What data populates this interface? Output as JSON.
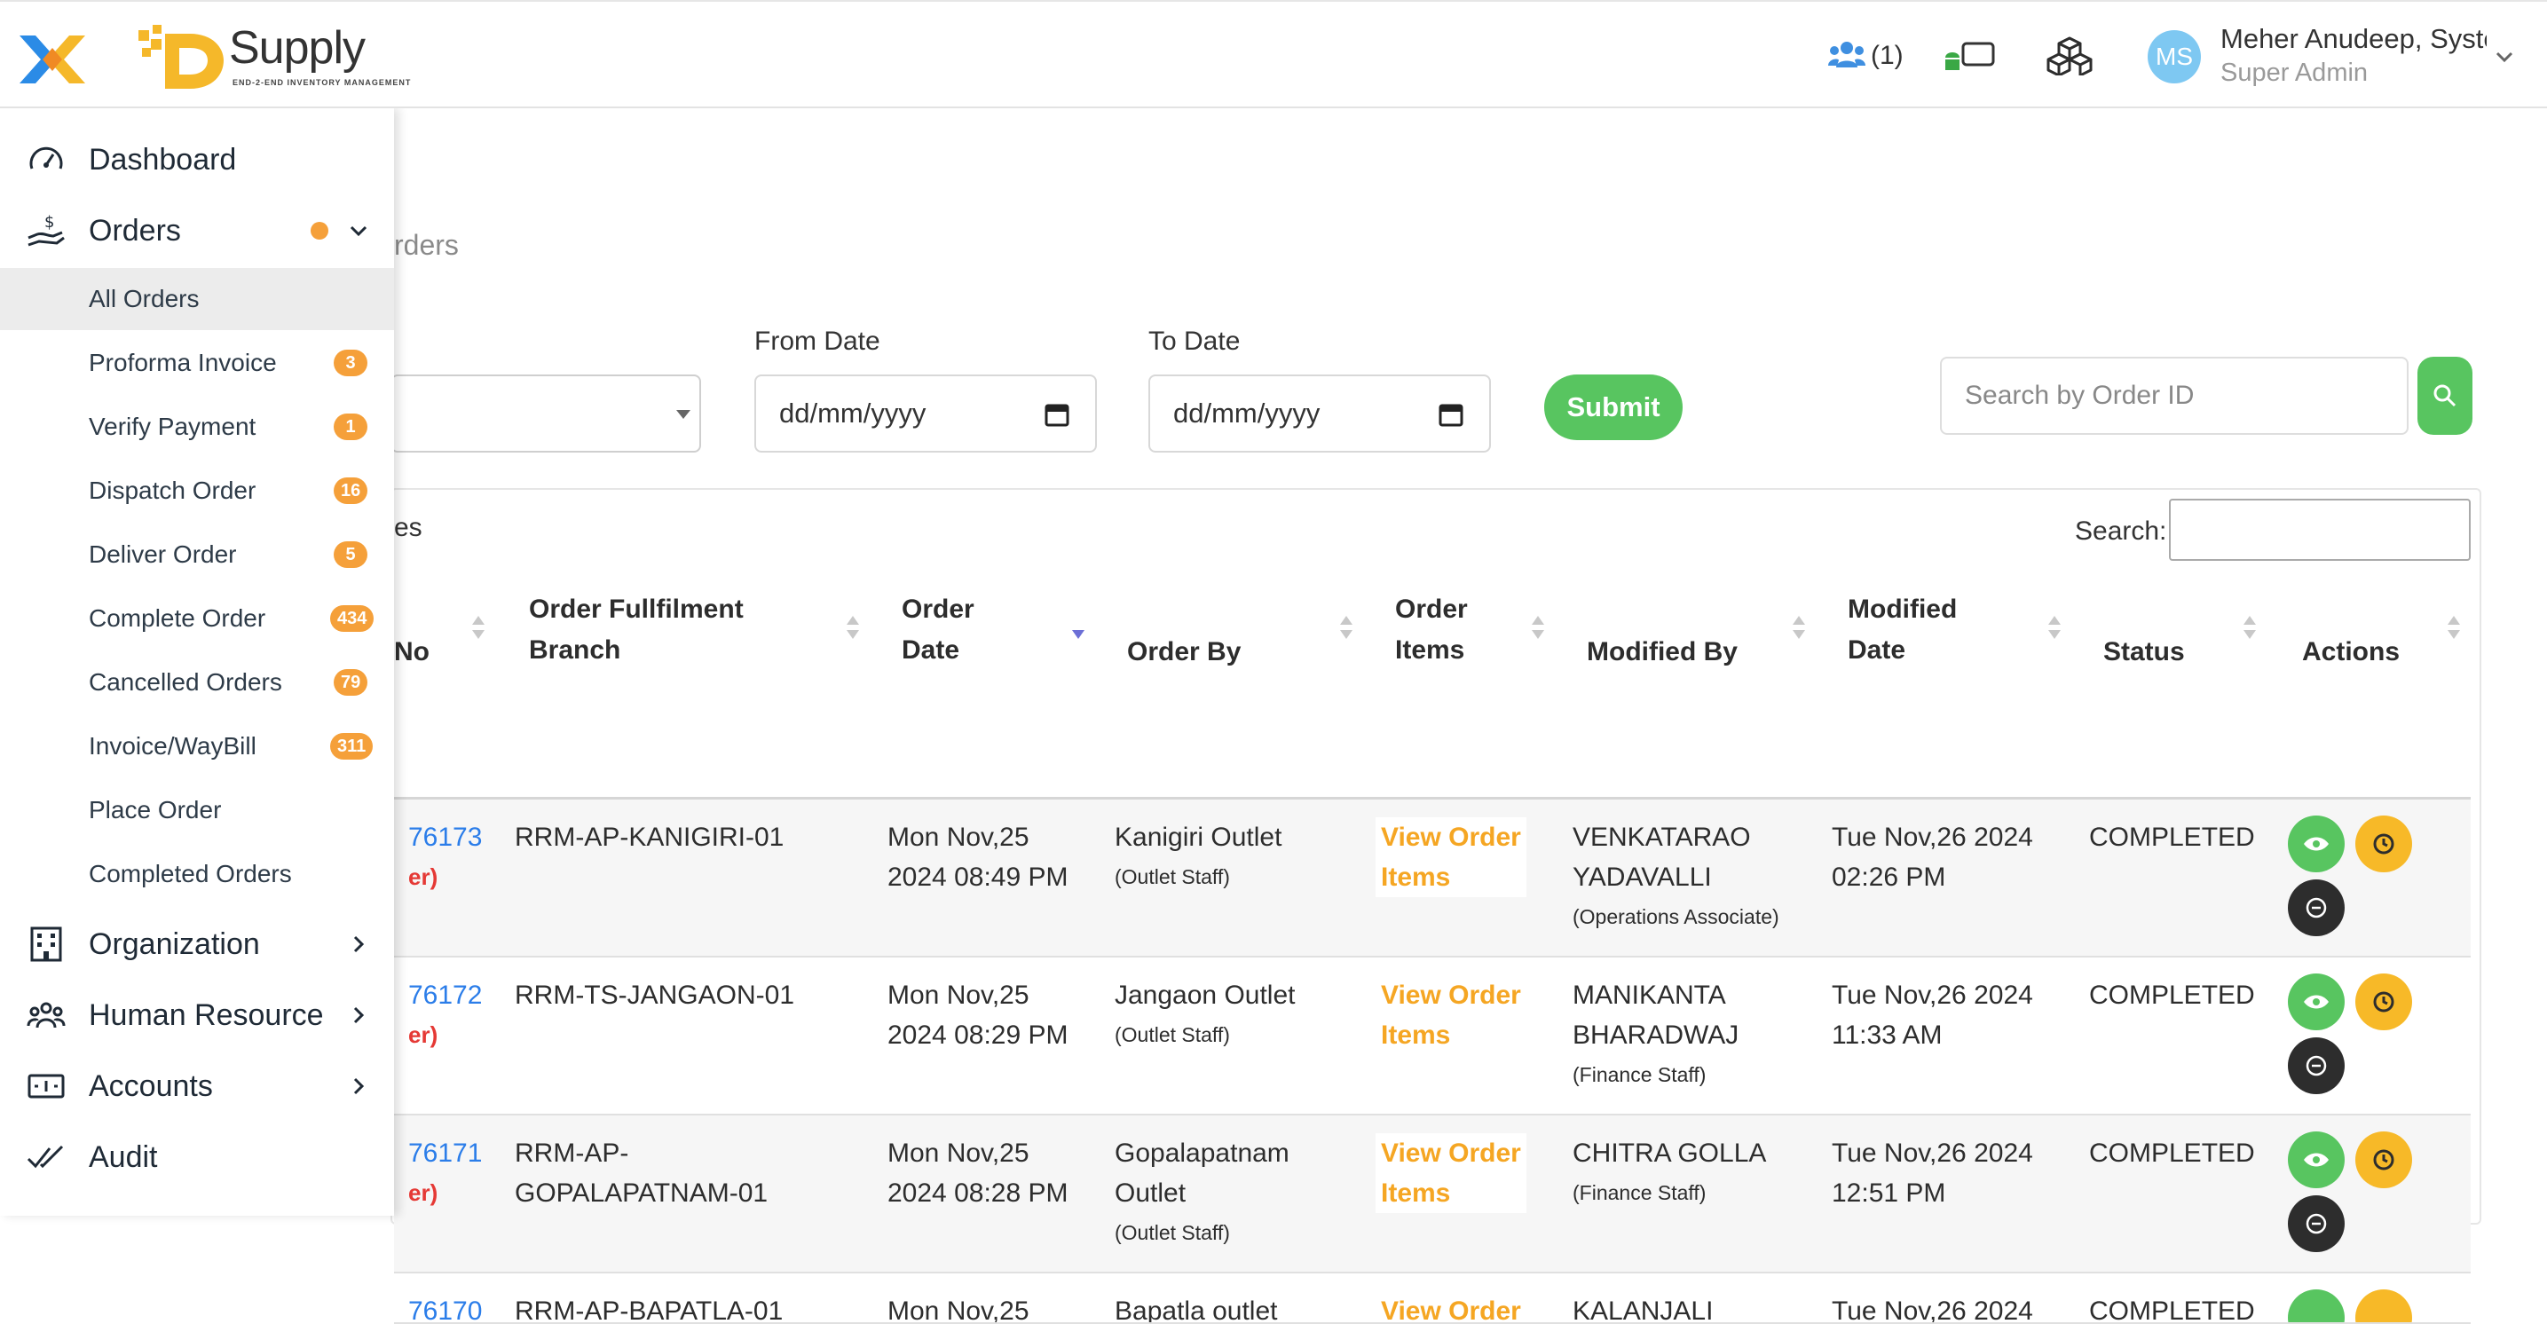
{
  "header": {
    "brand_word": "Supply",
    "brand_tagline": "END-2-END INVENTORY MANAGEMENT",
    "users_count": "(1)",
    "avatar_initials": "MS",
    "user_name": "Meher Anudeep, Syste",
    "user_role": "Super Admin"
  },
  "sidebar": {
    "dashboard": "Dashboard",
    "orders": "Orders",
    "sub_items": [
      {
        "label": "All Orders",
        "badge": ""
      },
      {
        "label": "Proforma Invoice",
        "badge": "3"
      },
      {
        "label": "Verify Payment",
        "badge": "1"
      },
      {
        "label": "Dispatch Order",
        "badge": "16"
      },
      {
        "label": "Deliver Order",
        "badge": "5"
      },
      {
        "label": "Complete Order",
        "badge": "434"
      },
      {
        "label": "Cancelled Orders",
        "badge": "79"
      },
      {
        "label": "Invoice/WayBill",
        "badge": "311"
      },
      {
        "label": "Place Order",
        "badge": ""
      },
      {
        "label": "Completed Orders",
        "badge": ""
      }
    ],
    "organization": "Organization",
    "human_resource": "Human Resource",
    "accounts": "Accounts",
    "audit": "Audit"
  },
  "main": {
    "breadcrumb": "rders",
    "from_date_label": "From Date",
    "to_date_label": "To Date",
    "date_placeholder": "dd/mm/yyyy",
    "submit": "Submit",
    "search_order_placeholder": "Search by Order ID",
    "entries_fragment": "es",
    "search_label": "Search:"
  },
  "table": {
    "headers": {
      "no": "No",
      "branch_1": "Order Fullfilment",
      "branch_2": "Branch",
      "date_1": "Order",
      "date_2": "Date",
      "by": "Order By",
      "items_1": "Order",
      "items_2": "Items",
      "modified_by": "Modified By",
      "mdate_1": "Modified",
      "mdate_2": "Date",
      "status": "Status",
      "actions": "Actions"
    },
    "view_items_1": "View Order",
    "view_items_2": "Items",
    "rows": [
      {
        "id": "76173",
        "id_sub": "er)",
        "branch_1": "RRM-AP-KANIGIRI-01",
        "branch_2": "",
        "date_1": "Mon Nov,25",
        "date_2": "2024 08:49 PM",
        "by_1": "Kanigiri Outlet",
        "by_2": "",
        "by_role": "(Outlet Staff)",
        "mod_1": "VENKATARAO",
        "mod_2": "YADAVALLI",
        "mod_role": "(Operations Associate)",
        "mdate_1": "Tue Nov,26 2024",
        "mdate_2": "02:26 PM",
        "status": "COMPLETED"
      },
      {
        "id": "76172",
        "id_sub": "er)",
        "branch_1": "RRM-TS-JANGAON-01",
        "branch_2": "",
        "date_1": "Mon Nov,25",
        "date_2": "2024 08:29 PM",
        "by_1": "Jangaon Outlet",
        "by_2": "",
        "by_role": "(Outlet Staff)",
        "mod_1": "MANIKANTA",
        "mod_2": "BHARADWAJ",
        "mod_role": "(Finance Staff)",
        "mdate_1": "Tue Nov,26 2024",
        "mdate_2": "11:33 AM",
        "status": "COMPLETED"
      },
      {
        "id": "76171",
        "id_sub": "er)",
        "branch_1": "RRM-AP-",
        "branch_2": "GOPALAPATNAM-01",
        "date_1": "Mon Nov,25",
        "date_2": "2024 08:28 PM",
        "by_1": "Gopalapatnam",
        "by_2": "Outlet",
        "by_role": "(Outlet Staff)",
        "mod_1": "CHITRA GOLLA",
        "mod_2": "",
        "mod_role": "(Finance Staff)",
        "mdate_1": "Tue Nov,26 2024",
        "mdate_2": "12:51 PM",
        "status": "COMPLETED"
      },
      {
        "id": "76170",
        "id_sub": "",
        "branch_1": "RRM-AP-BAPATLA-01",
        "branch_2": "",
        "date_1": "Mon Nov,25",
        "date_2": "",
        "by_1": "Bapatla outlet",
        "by_2": "",
        "by_role": "",
        "mod_1": "KALANJALI",
        "mod_2": "",
        "mod_role": "",
        "mdate_1": "Tue Nov,26 2024",
        "mdate_2": "",
        "status": "COMPLETED"
      }
    ]
  }
}
